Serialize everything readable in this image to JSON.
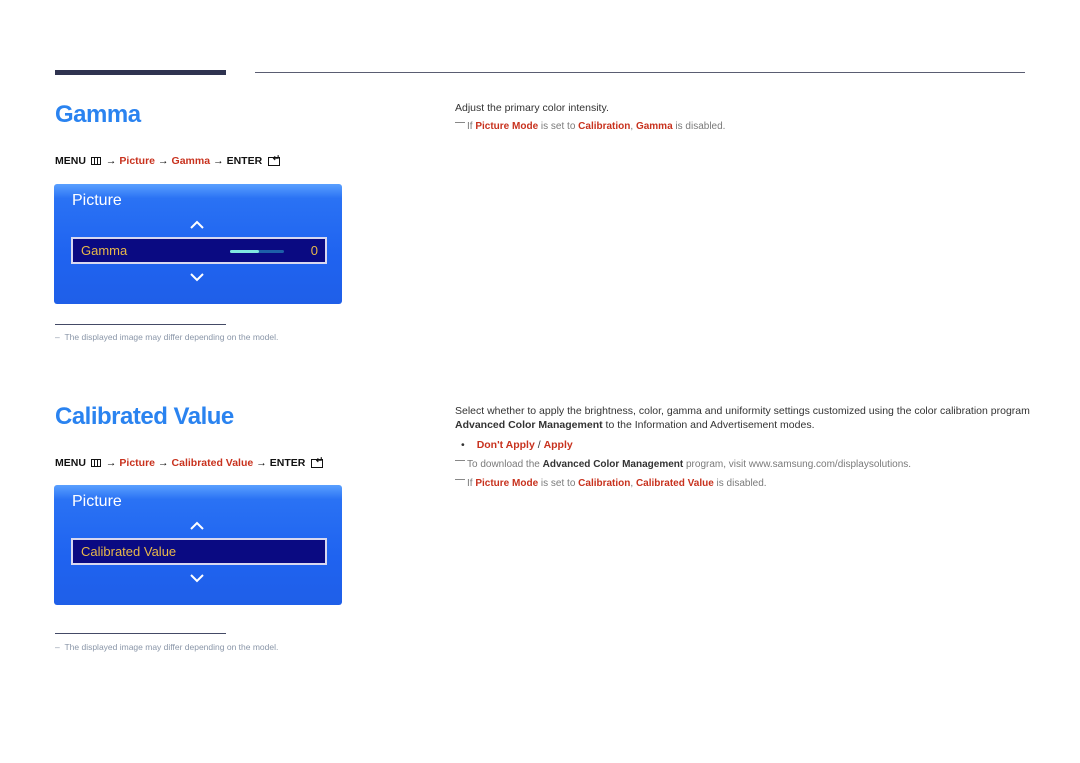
{
  "sections": [
    {
      "title": "Gamma",
      "menu_path": {
        "menu": "MENU",
        "arrow": "→",
        "picture": "Picture",
        "item": "Gamma",
        "enter": "ENTER"
      },
      "osd": {
        "title": "Picture",
        "row_label": "Gamma",
        "slider_fraction": 0.53,
        "value": "0"
      },
      "footnote": "The displayed image may differ depending on the model.",
      "description": "Adjust the primary color intensity.",
      "notes": [
        {
          "prefix": "If ",
          "mode": "Picture Mode",
          "mid": " is set to ",
          "cal": "Calibration",
          "sep": ", ",
          "item": "Gamma",
          "suffix": " is disabled."
        }
      ]
    },
    {
      "title": "Calibrated Value",
      "menu_path": {
        "menu": "MENU",
        "arrow": "→",
        "picture": "Picture",
        "item": "Calibrated Value",
        "enter": "ENTER"
      },
      "osd": {
        "title": "Picture",
        "row_label": "Calibrated Value"
      },
      "footnote": "The displayed image may differ depending on the model.",
      "description_part1": "Select whether to apply the brightness, color, gamma and uniformity settings customized using the color calibration program ",
      "description_bold": "Advanced Color Management",
      "description_part2": " to the Information and Advertisement modes.",
      "options": {
        "opt1": "Don't Apply",
        "sep": " / ",
        "opt2": "Apply"
      },
      "download_note": {
        "prefix": "To download the ",
        "bold": "Advanced Color Management",
        "suffix": " program, visit www.samsung.com/displaysolutions."
      },
      "notes": [
        {
          "prefix": "If ",
          "mode": "Picture Mode",
          "mid": " is set to ",
          "cal": "Calibration",
          "sep": ", ",
          "item": "Calibrated Value",
          "suffix": " is disabled."
        }
      ]
    }
  ]
}
